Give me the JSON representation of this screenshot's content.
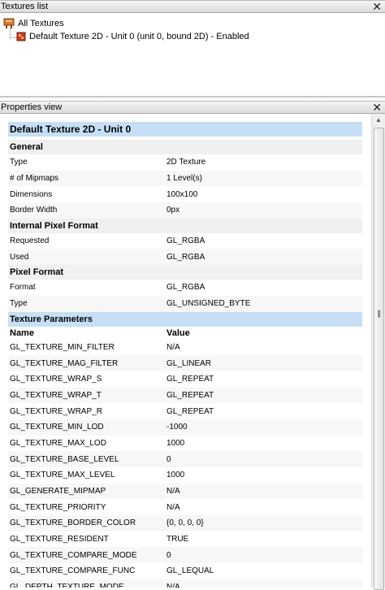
{
  "textures_panel": {
    "title": "Textures list",
    "close": "✕",
    "root": "All Textures",
    "child": "Default Texture 2D - Unit 0 (unit 0, bound 2D) - Enabled"
  },
  "properties_panel": {
    "title": "Properties view",
    "close": "✕",
    "heading": "Default Texture 2D - Unit 0",
    "general": {
      "label": "General",
      "rows": [
        {
          "k": "Type",
          "v": "2D Texture"
        },
        {
          "k": "# of Mipmaps",
          "v": "1 Level(s)"
        },
        {
          "k": "Dimensions",
          "v": "100x100"
        },
        {
          "k": "Border Width",
          "v": "0px"
        }
      ]
    },
    "internal": {
      "label": "Internal Pixel Format",
      "rows": [
        {
          "k": "Requested",
          "v": "GL_RGBA"
        },
        {
          "k": "Used",
          "v": "GL_RGBA"
        }
      ]
    },
    "pixel": {
      "label": "Pixel Format",
      "rows": [
        {
          "k": "Format",
          "v": "GL_RGBA"
        },
        {
          "k": "Type",
          "v": "GL_UNSIGNED_BYTE"
        }
      ]
    },
    "params": {
      "label": "Texture Parameters",
      "col_name": "Name",
      "col_value": "Value",
      "rows": [
        {
          "k": "GL_TEXTURE_MIN_FILTER",
          "v": "N/A"
        },
        {
          "k": "GL_TEXTURE_MAG_FILTER",
          "v": "GL_LINEAR"
        },
        {
          "k": "GL_TEXTURE_WRAP_S",
          "v": "GL_REPEAT"
        },
        {
          "k": "GL_TEXTURE_WRAP_T",
          "v": "GL_REPEAT"
        },
        {
          "k": "GL_TEXTURE_WRAP_R",
          "v": "GL_REPEAT"
        },
        {
          "k": "GL_TEXTURE_MIN_LOD",
          "v": "-1000"
        },
        {
          "k": "GL_TEXTURE_MAX_LOD",
          "v": "1000"
        },
        {
          "k": "GL_TEXTURE_BASE_LEVEL",
          "v": "0"
        },
        {
          "k": "GL_TEXTURE_MAX_LEVEL",
          "v": "1000"
        },
        {
          "k": "GL_GENERATE_MIPMAP",
          "v": "N/A"
        },
        {
          "k": "GL_TEXTURE_PRIORITY",
          "v": "N/A"
        },
        {
          "k": "GL_TEXTURE_BORDER_COLOR",
          "v": "{0, 0, 0, 0}"
        },
        {
          "k": "GL_TEXTURE_RESIDENT",
          "v": "TRUE"
        },
        {
          "k": "GL_TEXTURE_COMPARE_MODE",
          "v": "0"
        },
        {
          "k": "GL_TEXTURE_COMPARE_FUNC",
          "v": "GL_LEQUAL"
        },
        {
          "k": "GL_DEPTH_TEXTURE_MODE",
          "v": "N/A"
        }
      ]
    }
  },
  "colors": {
    "section_highlight": "#c6dff6",
    "header_bg": "#dcdcdc"
  }
}
